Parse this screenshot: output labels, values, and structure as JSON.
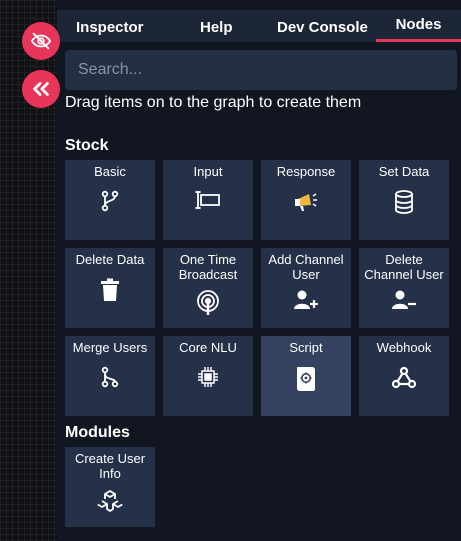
{
  "tabs": [
    {
      "label": "Inspector",
      "active": false
    },
    {
      "label": "Help",
      "active": false
    },
    {
      "label": "Dev Console",
      "active": false
    },
    {
      "label": "Nodes",
      "active": true
    }
  ],
  "search": {
    "placeholder": "Search..."
  },
  "hint": "Drag items on to the graph to create them",
  "sections": {
    "stock": "Stock",
    "modules": "Modules"
  },
  "stock_nodes": [
    {
      "label": "Basic",
      "icon": "branch-icon"
    },
    {
      "label": "Input",
      "icon": "text-cursor-icon"
    },
    {
      "label": "Response",
      "icon": "megaphone-icon"
    },
    {
      "label": "Set Data",
      "icon": "database-icon"
    },
    {
      "label": "Delete Data",
      "icon": "trash-icon"
    },
    {
      "label": "One Time Broadcast",
      "icon": "broadcast-icon"
    },
    {
      "label": "Add Channel User",
      "icon": "user-plus-icon"
    },
    {
      "label": "Delete Channel User",
      "icon": "user-minus-icon"
    },
    {
      "label": "Merge Users",
      "icon": "merge-icon"
    },
    {
      "label": "Core NLU",
      "icon": "chip-icon"
    },
    {
      "label": "Script",
      "icon": "script-icon"
    },
    {
      "label": "Webhook",
      "icon": "webhook-icon"
    }
  ],
  "module_nodes": [
    {
      "label": "Create User Info",
      "icon": "modules-icon"
    }
  ],
  "colors": {
    "accent": "#e8355a",
    "tile": "#253148",
    "tile_active": "#34425f",
    "tab_bar": "#1d2637",
    "search_bg": "#232f45",
    "megaphone": "#f5b83d"
  }
}
